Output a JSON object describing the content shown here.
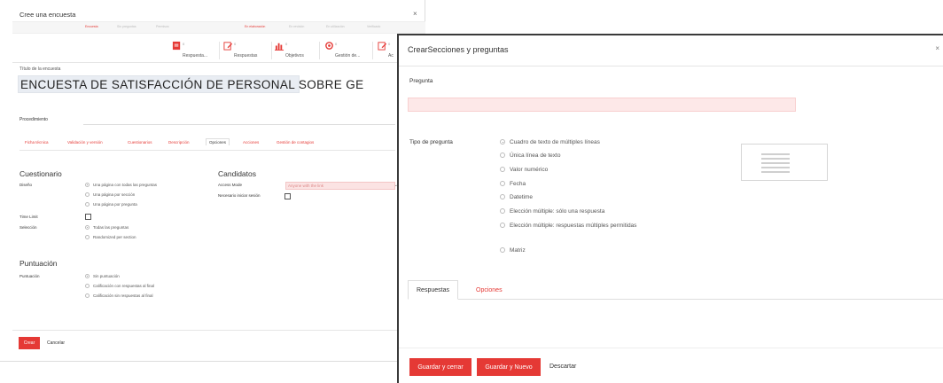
{
  "back_dialog": {
    "title": "Cree una encuesta",
    "close": "×",
    "steps": [
      "Encuesta",
      "Sin preguntas",
      "Permisos",
      "En elaboración",
      "En revisión",
      "En utilización",
      "Verificado"
    ],
    "toolbar": [
      {
        "count": "0",
        "label": "Respuesta..."
      },
      {
        "count": "0",
        "label": "Respuestas"
      },
      {
        "count": "0",
        "label": "Objetivos"
      },
      {
        "count": "0",
        "label": "Gestión de..."
      },
      {
        "count": "0",
        "label": "Ac"
      }
    ],
    "survey_title_label": "Título de la encuesta",
    "survey_title_value": "ENCUESTA DE SATISFACCIÓN DE  PERSONAL SOBRE GE",
    "procedure_label": "Procedimiento",
    "tabs": [
      "Ficha técnica",
      "Validación y versión",
      "Cuestionarios",
      "Descripción",
      "Opciones",
      "Acciones",
      "Gestión de contagios"
    ],
    "cuestionario": {
      "heading": "Cuestionario",
      "diseno_label": "Diseño",
      "diseno_options": [
        "Una página con todas las preguntas",
        "Una página por sección",
        "Una página por pregunta"
      ],
      "time_limit_label": "Time Limit",
      "seleccion_label": "Selección",
      "seleccion_options": [
        "Todas las preguntas",
        "Randomized per section"
      ]
    },
    "candidatos": {
      "heading": "Candidatos",
      "access_mode_label": "Access Mode",
      "access_mode_value": "Anyone with the link",
      "login_label": "Necesario iniciar sesión"
    },
    "puntuacion": {
      "heading": "Puntuación",
      "label": "Puntuación",
      "options": [
        "Sin puntuación",
        "Calificación con respuestas al final",
        "Calificación sin respuestas al final"
      ]
    },
    "create_button": "Crear",
    "cancel_button": "Cancelar"
  },
  "front_dialog": {
    "title": "CrearSecciones y preguntas",
    "close": "×",
    "question_label": "Pregunta",
    "question_value": "",
    "type_label": "Tipo de pregunta",
    "type_options": [
      "Cuadro de texto de múltiples líneas",
      "Única línea de texto",
      "Valor numérico",
      "Fecha",
      "Datetime",
      "Elección múltiple: sólo una respuesta",
      "Elección múltiple: respuestas múltiples permitidas",
      "Matriz"
    ],
    "tabs": [
      "Respuestas",
      "Opciones"
    ],
    "save_close_button": "Guardar y cerrar",
    "save_new_button": "Guardar y Nuevo",
    "discard_button": "Descartar"
  },
  "colors": {
    "accent": "#e53935",
    "input_error_bg": "#fde8e8",
    "title_input_bg": "#e9edf3"
  }
}
